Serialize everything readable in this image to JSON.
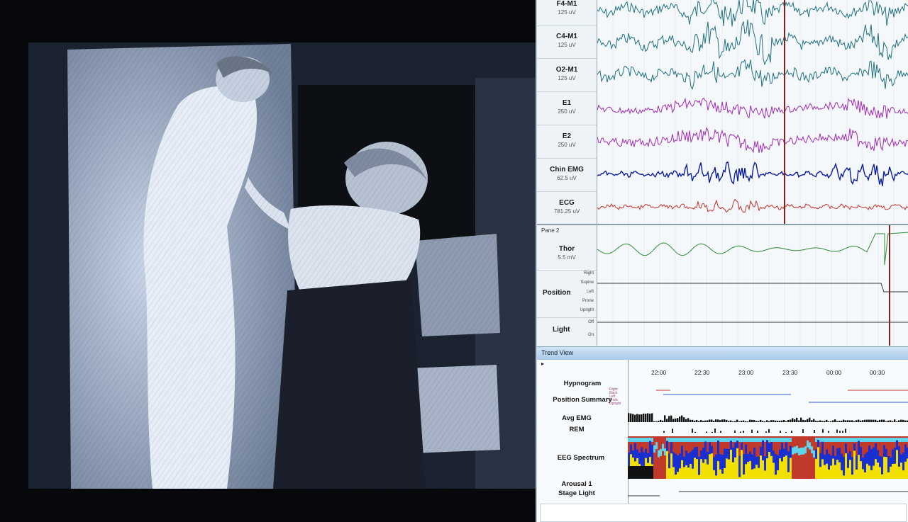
{
  "pane1": {
    "channels": [
      {
        "name": "F4-M1",
        "gain": "125 uV",
        "color": "#1f6f80"
      },
      {
        "name": "C4-M1",
        "gain": "125 uV",
        "color": "#1f6f80"
      },
      {
        "name": "O2-M1",
        "gain": "125 uV",
        "color": "#1f6f80"
      },
      {
        "name": "E1",
        "gain": "250 uV",
        "color": "#a12ab7"
      },
      {
        "name": "E2",
        "gain": "250 uV",
        "color": "#a12ab7"
      },
      {
        "name": "Chin EMG",
        "gain": "62.5 uV",
        "color": "#0a1b9c"
      },
      {
        "name": "ECG",
        "gain": "781.25 uV",
        "color": "#c8302a"
      }
    ]
  },
  "pane2": {
    "title": "Pane 2",
    "thor": {
      "name": "Thor",
      "gain": "5.5 mV",
      "color": "#2f8a3a"
    },
    "position": {
      "label": "Position",
      "ticks": [
        "Right",
        "Supine",
        "Left",
        "Prone",
        "Upright"
      ]
    },
    "light": {
      "label": "Light",
      "ticks": [
        "Off",
        "On"
      ]
    }
  },
  "trend_view": {
    "title": "Trend View",
    "play_icon": "play-icon",
    "times": [
      "22:00",
      "22:30",
      "23:00",
      "23:30",
      "00:00",
      "00:30"
    ],
    "rows": {
      "hypnogram": "Hypnogram",
      "position_summary": "Position Summary",
      "avg_emg": "Avg EMG",
      "rem": "REM",
      "eeg_spectrum": "EEG Spectrum",
      "arousal": "Arousal 1",
      "stage_light": "Stage Light"
    },
    "position_ticks": [
      "Right",
      "Back",
      "Left",
      "Front",
      "Upright"
    ]
  },
  "colors": {
    "cursor": "#8a1f1a",
    "spectrum_red": "#c0392b",
    "spectrum_yellow": "#f2e000",
    "spectrum_blue": "#1a2fd0",
    "spectrum_cyan": "#5fd4e8"
  }
}
